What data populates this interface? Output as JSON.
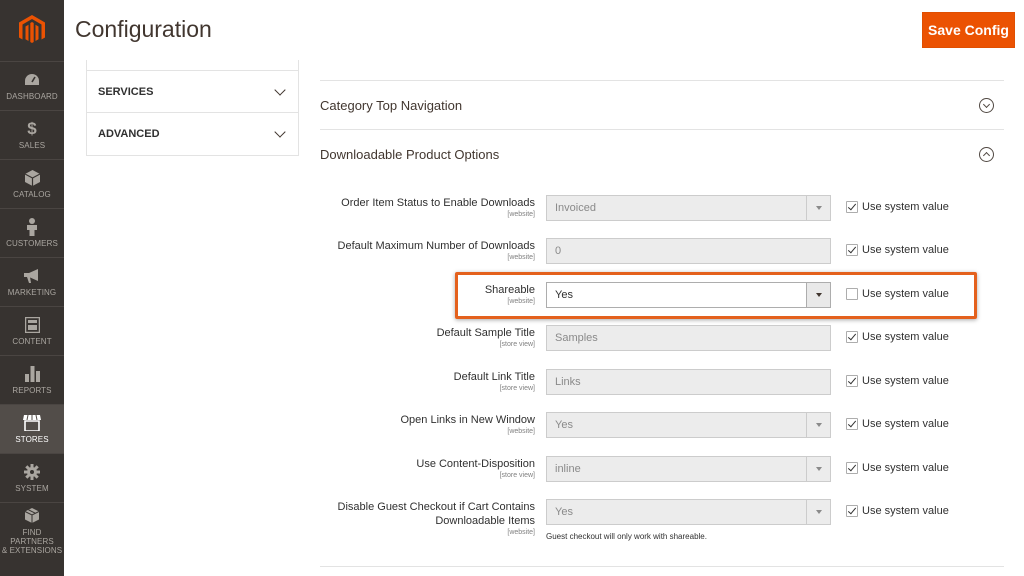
{
  "nav": {
    "items": [
      {
        "label": "DASHBOARD",
        "icon": "dashboard-icon"
      },
      {
        "label": "SALES",
        "icon": "dollar-icon"
      },
      {
        "label": "CATALOG",
        "icon": "cube-icon"
      },
      {
        "label": "CUSTOMERS",
        "icon": "person-icon"
      },
      {
        "label": "MARKETING",
        "icon": "megaphone-icon"
      },
      {
        "label": "CONTENT",
        "icon": "layout-icon"
      },
      {
        "label": "REPORTS",
        "icon": "bar-chart-icon"
      },
      {
        "label": "STORES",
        "icon": "storefront-icon",
        "active": true
      },
      {
        "label": "SYSTEM",
        "icon": "gear-icon"
      },
      {
        "label": "FIND PARTNERS",
        "label2": "& EXTENSIONS",
        "icon": "boxes-icon"
      }
    ],
    "brand_color": "#eb5202",
    "bg_color": "#373330"
  },
  "header": {
    "title": "Configuration",
    "save_label": "Save Config"
  },
  "tabs": [
    {
      "label": "SERVICES"
    },
    {
      "label": "ADVANCED"
    }
  ],
  "sections": {
    "category_nav": "Category Top Navigation",
    "downloadable": "Downloadable Product Options"
  },
  "rows": [
    {
      "label": "Order Item Status to Enable Downloads",
      "scope": "[website]",
      "type": "select",
      "value": "Invoiced",
      "use_system": true
    },
    {
      "label": "Default Maximum Number of Downloads",
      "scope": "[website]",
      "type": "text",
      "value": "0",
      "use_system": true
    },
    {
      "label": "Shareable",
      "scope": "[website]",
      "type": "select",
      "value": "Yes",
      "use_system": false
    },
    {
      "label": "Default Sample Title",
      "scope": "[store view]",
      "type": "text",
      "value": "Samples",
      "use_system": true
    },
    {
      "label": "Default Link Title",
      "scope": "[store view]",
      "type": "text",
      "value": "Links",
      "use_system": true
    },
    {
      "label": "Open Links in New Window",
      "scope": "[website]",
      "type": "select",
      "value": "Yes",
      "use_system": true
    },
    {
      "label": "Use Content-Disposition",
      "scope": "[store view]",
      "type": "select",
      "value": "inline",
      "use_system": true
    },
    {
      "label": "Disable Guest Checkout if Cart Contains",
      "label2": "Downloadable Items",
      "scope": "[website]",
      "type": "select",
      "value": "Yes",
      "use_system": true,
      "note": "Guest checkout will only work with shareable."
    }
  ],
  "use_system_label": "Use system value",
  "highlight_color": "#e4611d"
}
